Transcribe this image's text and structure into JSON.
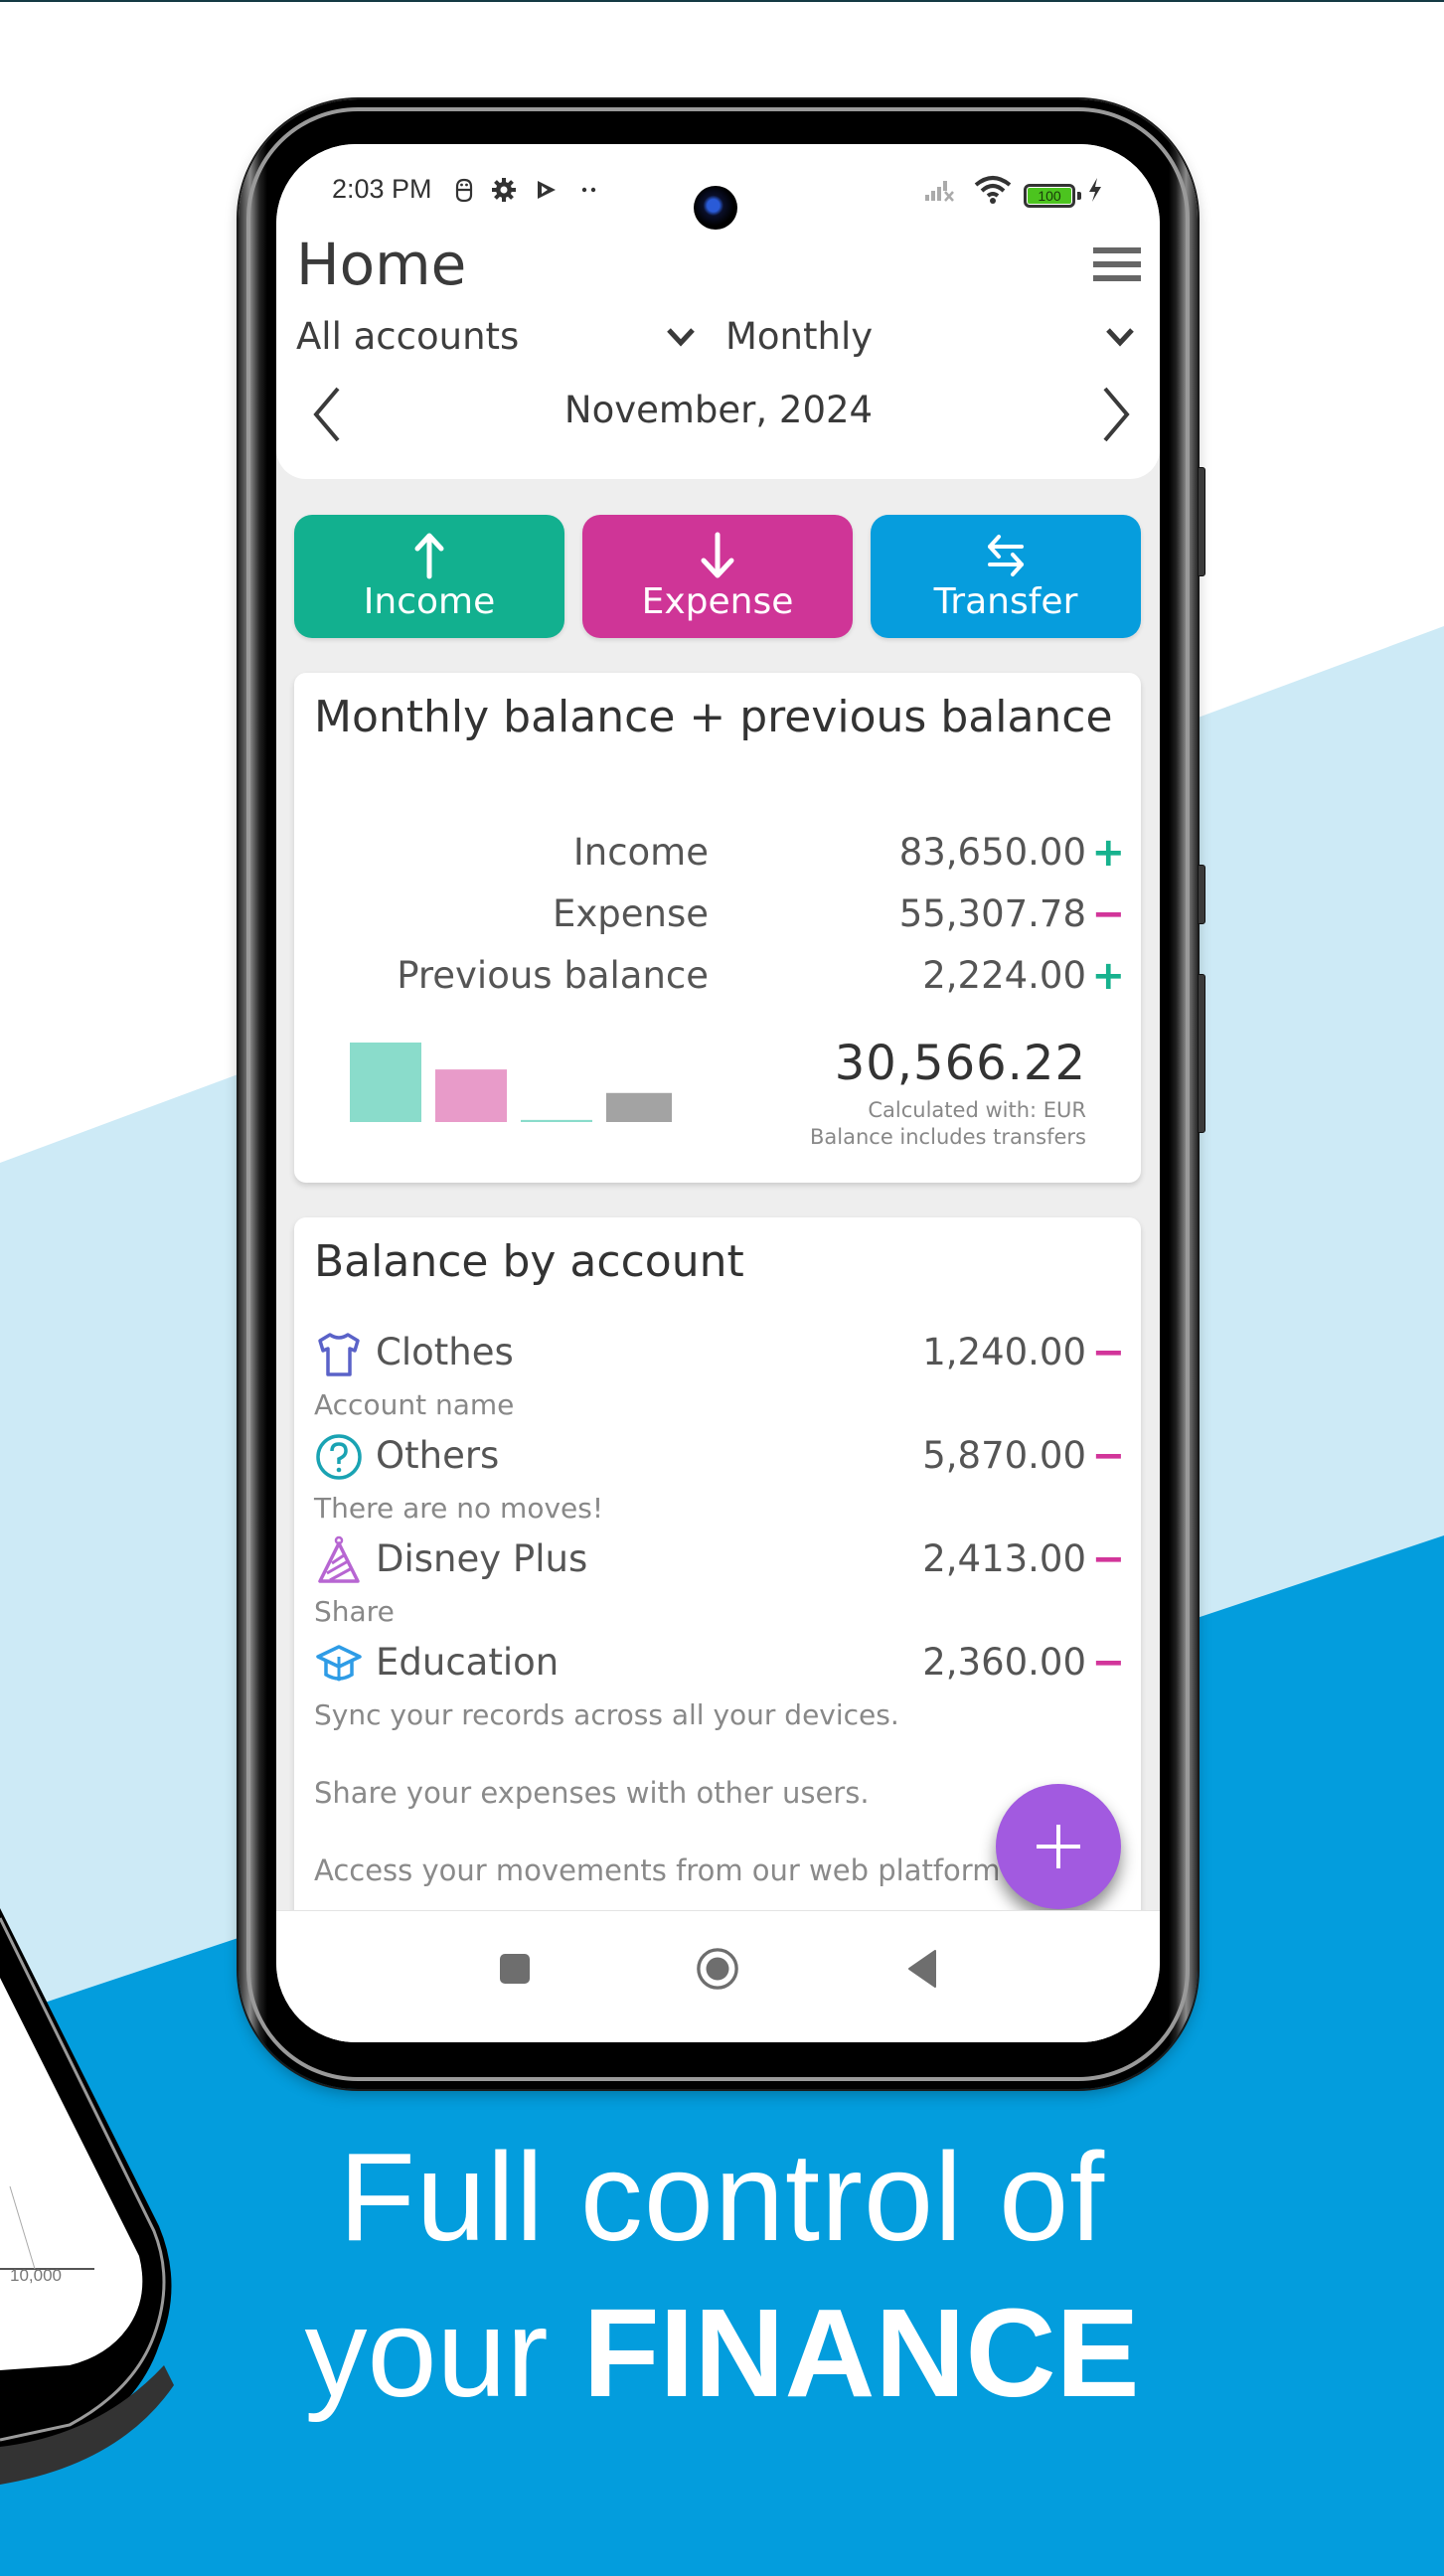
{
  "status_bar": {
    "time": "2:03 PM",
    "icons": [
      "android-debug-icon",
      "settings-gear-icon",
      "play-store-icon",
      "more-dots-icon"
    ],
    "right_icons": [
      "signal-no-service-icon",
      "wifi-icon",
      "battery-icon",
      "charging-bolt-icon"
    ],
    "battery_level": "100"
  },
  "header": {
    "title": "Home",
    "menu_icon": "hamburger-menu-icon",
    "account_filter": "All accounts",
    "period_filter": "Monthly",
    "current_period": "November, 2024"
  },
  "actions": [
    {
      "label": "Income",
      "icon": "arrow-up-icon",
      "color": "#12b08f"
    },
    {
      "label": "Expense",
      "icon": "arrow-down-icon",
      "color": "#cf3597"
    },
    {
      "label": "Transfer",
      "icon": "transfer-arrows-icon",
      "color": "#069ddd"
    }
  ],
  "balance_card": {
    "title": "Monthly balance + previous balance",
    "rows": [
      {
        "label": "Income",
        "value": "83,650.00",
        "sign": "+"
      },
      {
        "label": "Expense",
        "value": "55,307.78",
        "sign": "−"
      },
      {
        "label": "Previous balance",
        "value": "2,224.00",
        "sign": "+"
      }
    ],
    "total": "30,566.22",
    "note_currency": "Calculated with: EUR",
    "note_transfers": "Balance includes transfers"
  },
  "chart_data": {
    "type": "bar",
    "title": "",
    "categories": [
      "Income",
      "Expense",
      "Previous balance",
      "Balance"
    ],
    "values": [
      83650.0,
      55307.78,
      2224.0,
      30566.22
    ],
    "colors": [
      "#8adccb",
      "#e89bc9",
      "#8adccb",
      "#a3a3a3"
    ],
    "xlabel": "",
    "ylabel": "",
    "ylim": [
      0,
      83650
    ]
  },
  "accounts_card": {
    "title": "Balance by account",
    "accounts": [
      {
        "name": "Clothes",
        "value": "1,240.00",
        "sign": "−",
        "icon": "t-shirt-icon",
        "icon_color": "#5a62c8",
        "subtitle": "Account name"
      },
      {
        "name": "Others",
        "value": "5,870.00",
        "sign": "−",
        "icon": "question-circle-icon",
        "icon_color": "#1aa3b3",
        "subtitle": "There are no moves!"
      },
      {
        "name": "Disney Plus",
        "value": "2,413.00",
        "sign": "−",
        "icon": "party-hat-icon",
        "icon_color": "#b766d2",
        "subtitle": "Share"
      },
      {
        "name": "Education",
        "value": "2,360.00",
        "sign": "−",
        "icon": "graduation-cap-icon",
        "icon_color": "#2e9ce6",
        "subtitle": "Sync your records across all your devices."
      }
    ],
    "promos": [
      "Share your expenses with other users.",
      "Access your movements from our web platform"
    ]
  },
  "fab": {
    "icon": "plus-icon"
  },
  "nav_bar": {
    "buttons": [
      "recents-square-icon",
      "home-circle-icon",
      "back-triangle-icon"
    ]
  },
  "background_phone": {
    "axis_label": "10,000"
  },
  "tagline": {
    "line1": "Full control of",
    "line2_regular": "your ",
    "line2_bold": "FINANCE"
  },
  "colors": {
    "light_blue": "#cdeaf6",
    "brand_blue": "#039ddd",
    "income_green": "#17b28e",
    "expense_pink": "#d2359a",
    "fab_purple": "#a25ae0"
  }
}
